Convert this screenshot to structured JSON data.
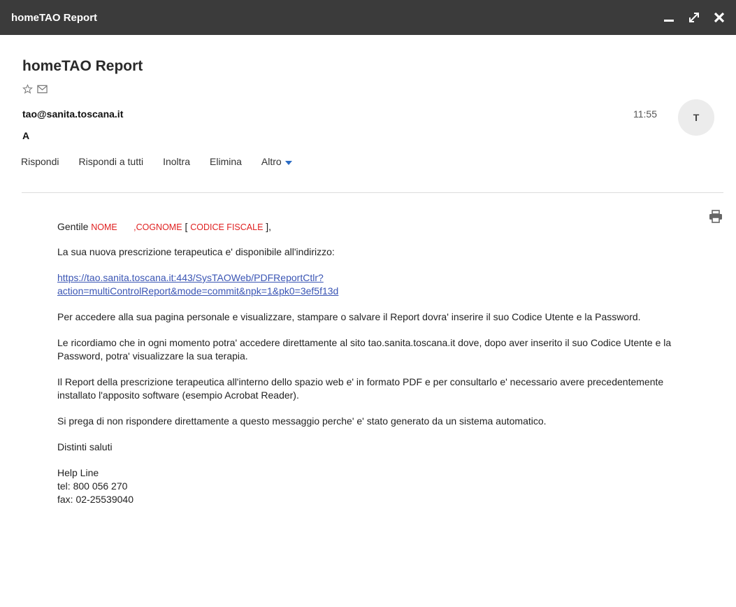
{
  "window": {
    "title": "homeTAO Report"
  },
  "message": {
    "subject": "homeTAO Report",
    "sender": "tao@sanita.toscana.it",
    "to": "A",
    "time": "11:55",
    "avatar_initial": "T"
  },
  "actions": {
    "reply": "Rispondi",
    "reply_all": "Rispondi a tutti",
    "forward": "Inoltra",
    "delete": "Elimina",
    "more": "Altro"
  },
  "body": {
    "greeting_prefix": "Gentile",
    "nome": "NOME",
    "cognome": ",COGNOME",
    "bracket_open": "[",
    "codice": "CODICE FISCALE",
    "bracket_close": "],",
    "p1": "La sua nuova prescrizione terapeutica e' disponibile all'indirizzo:",
    "link_line1": "https://tao.sanita.toscana.it:443/SysTAOWeb/PDFReportCtlr?",
    "link_line2": "action=multiControlReport&mode=commit&npk=1&pk0=3ef5f13d",
    "p2": "Per accedere alla sua pagina personale e visualizzare, stampare o salvare il Report dovra' inserire il suo Codice Utente e la Password.",
    "p3": "Le ricordiamo che in ogni momento potra' accedere direttamente al sito tao.sanita.toscana.it dove, dopo aver inserito il suo Codice Utente e la Password, potra' visualizzare la sua terapia.",
    "p4": "Il Report della prescrizione terapeutica all'interno dello spazio web e' in formato PDF e per consultarlo e' necessario avere precedentemente installato l'apposito software (esempio Acrobat Reader).",
    "p5": "Si prega di non rispondere direttamente a questo messaggio perche' e' stato generato da un sistema automatico.",
    "closing": "Distinti saluti",
    "sig_name": "Help Line",
    "sig_tel": "tel: 800 056 270",
    "sig_fax": "fax: 02-25539040"
  },
  "icons": [
    "minimize-icon",
    "expand-icon",
    "close-icon",
    "star-icon",
    "envelope-icon",
    "chevron-down-icon",
    "print-icon"
  ],
  "colors": {
    "titlebar": "#3b3b3b",
    "placeholder_red": "#e02020",
    "link": "#3a55b4",
    "accent_blue": "#2b6cc4"
  }
}
